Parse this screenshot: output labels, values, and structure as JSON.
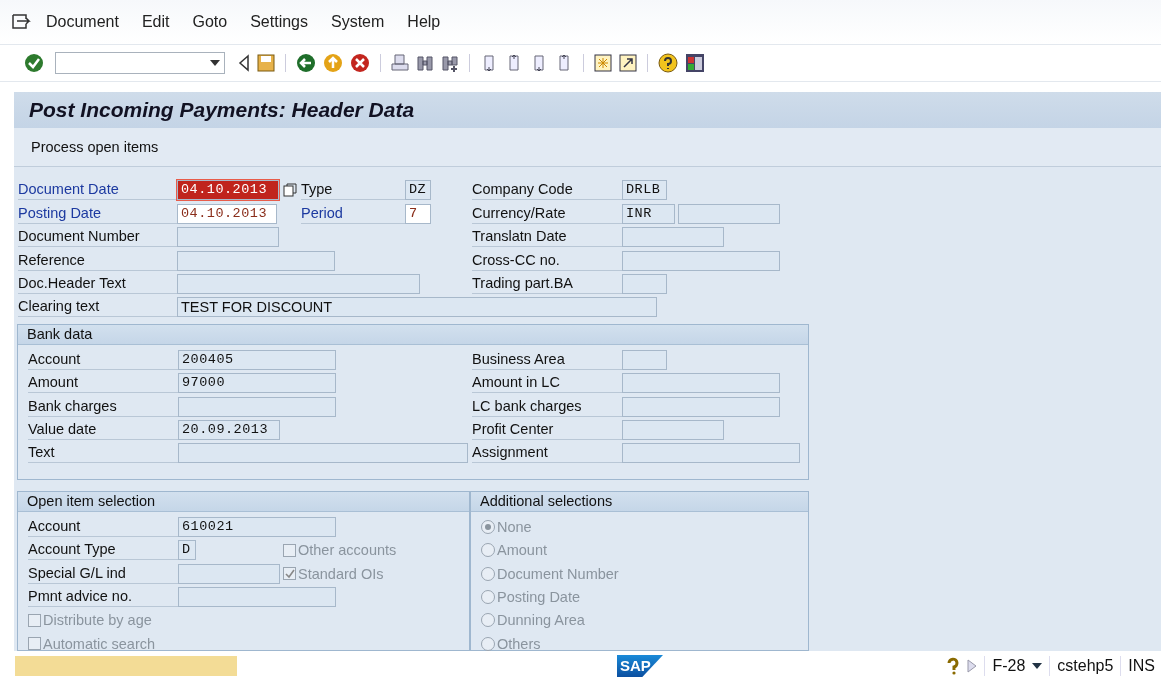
{
  "menu": [
    "Document",
    "Edit",
    "Goto",
    "Settings",
    "System",
    "Help"
  ],
  "title": "Post Incoming Payments: Header Data",
  "app_toolbar": [
    "Process open items"
  ],
  "header": {
    "rows": [
      {
        "left": {
          "label": "Document Date",
          "required": true,
          "value": "04.10.2013",
          "focused": true
        },
        "middle": {
          "label": "Type",
          "required": false,
          "value": "DZ"
        },
        "right": {
          "label": "Company Code",
          "value": "DRLB"
        }
      },
      {
        "left": {
          "label": "Posting Date",
          "required": true,
          "value": "04.10.2013",
          "focused": false
        },
        "middle": {
          "label": "Period",
          "required": true,
          "value": "7"
        },
        "right": {
          "label": "Currency/Rate",
          "value": "INR",
          "rate_field": true
        }
      },
      {
        "left": {
          "label": "Document Number",
          "required": false,
          "focused": false
        },
        "right": {
          "label": "Translatn Date"
        }
      },
      {
        "left": {
          "label": "Reference",
          "required": false,
          "focused": false
        },
        "right": {
          "label": "Cross-CC no."
        }
      },
      {
        "left": {
          "label": "Doc.Header Text",
          "required": false,
          "focused": false
        },
        "right": {
          "label": "Trading part.BA"
        }
      },
      {
        "left": {
          "label": "Clearing text",
          "required": false,
          "value": "TEST FOR DISCOUNT",
          "focused": false
        }
      }
    ]
  },
  "bank_data": {
    "title": "Bank data",
    "rows": [
      {
        "left": {
          "label": "Account",
          "value": "200405"
        },
        "right": {
          "label": "Business Area"
        }
      },
      {
        "left": {
          "label": "Amount",
          "value": "97000"
        },
        "right": {
          "label": "Amount in LC"
        }
      },
      {
        "left": {
          "label": "Bank charges"
        },
        "right": {
          "label": "LC bank charges"
        }
      },
      {
        "left": {
          "label": "Value date",
          "value": "20.09.2013"
        },
        "right": {
          "label": "Profit Center"
        }
      },
      {
        "left": {
          "label": "Text"
        },
        "right": {
          "label": "Assignment"
        }
      }
    ]
  },
  "open_item_selection": {
    "title": "Open item selection",
    "rows": [
      {
        "label": "Account",
        "value": "610021"
      },
      {
        "label": "Account Type",
        "value": "D",
        "checkbox": {
          "label": "Other accounts",
          "checked": false,
          "disabled": true
        }
      },
      {
        "label": "Special G/L ind",
        "checkbox": {
          "label": "Standard OIs",
          "checked": true,
          "disabled": true
        }
      },
      {
        "label": "Pmnt advice no."
      }
    ],
    "checkboxes": [
      {
        "label": "Distribute by age",
        "checked": false,
        "disabled": true
      },
      {
        "label": "Automatic search",
        "checked": false,
        "disabled": true
      }
    ]
  },
  "additional_selections": {
    "title": "Additional selections",
    "options": [
      {
        "label": "None",
        "selected": true,
        "disabled": true
      },
      {
        "label": "Amount",
        "selected": false,
        "disabled": true
      },
      {
        "label": "Document Number",
        "selected": false,
        "disabled": true
      },
      {
        "label": "Posting Date",
        "selected": false,
        "disabled": true
      },
      {
        "label": "Dunning Area",
        "selected": false,
        "disabled": true
      },
      {
        "label": "Others",
        "selected": false,
        "disabled": true
      }
    ]
  },
  "status_bar": {
    "logo": "SAP",
    "transaction": "F-28",
    "server": "cstehp5",
    "mode": "INS"
  }
}
